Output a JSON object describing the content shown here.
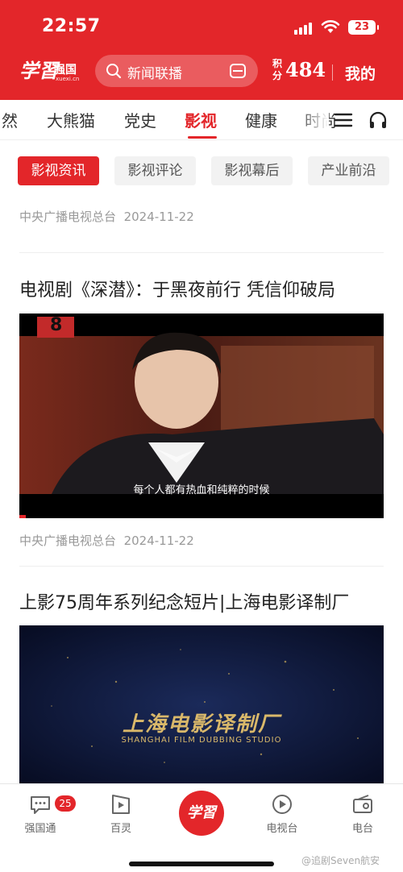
{
  "status_bar": {
    "time": "22:57",
    "battery": "23"
  },
  "header": {
    "logo_script": "学習",
    "logo_cn": "强国",
    "logo_url": "xuexi.cn",
    "search_placeholder": "新闻联播",
    "points_label": "积分",
    "points_value": "484",
    "mine_label": "我的",
    "accent_color": "#e3262a"
  },
  "tabs": [
    {
      "label": "自然"
    },
    {
      "label": "大熊猫"
    },
    {
      "label": "党史"
    },
    {
      "label": "影视",
      "active": true
    },
    {
      "label": "健康"
    },
    {
      "label": "时尚"
    }
  ],
  "chips": [
    {
      "label": "影视资讯",
      "active": true
    },
    {
      "label": "影视评论"
    },
    {
      "label": "影视幕后"
    },
    {
      "label": "产业前沿"
    }
  ],
  "feed": {
    "first_meta": {
      "source": "中央广播电视总台",
      "date": "2024-11-22"
    },
    "articles": [
      {
        "title": "电视剧《深潜》：于黑夜前行 凭信仰破局",
        "thumb_badge": "8",
        "thumb_subtitle": "每个人都有热血和纯粹的时候",
        "source": "中央广播电视总台",
        "date": "2024-11-22"
      },
      {
        "title": "上影75周年系列纪念短片|上海电影译制厂",
        "thumb_title": "上海电影译制厂",
        "thumb_subtitle": "SHANGHAI FILM DUBBING STUDIO"
      }
    ]
  },
  "bottom_nav": {
    "items": [
      {
        "label": "强国通",
        "badge": "25"
      },
      {
        "label": "百灵"
      },
      {
        "label": "学習",
        "center": true
      },
      {
        "label": "电视台"
      },
      {
        "label": "电台"
      }
    ],
    "watermark": "@追剧Seven航安"
  }
}
